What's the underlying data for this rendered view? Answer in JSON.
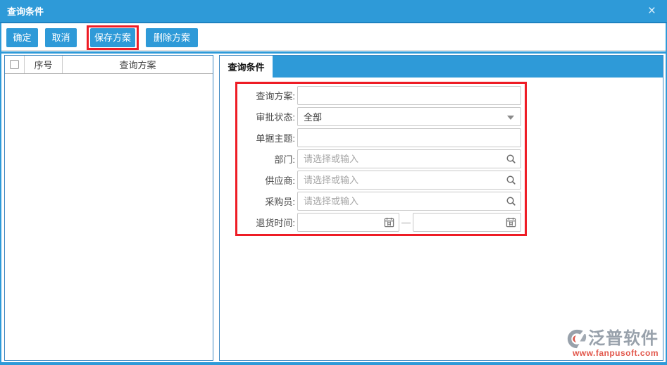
{
  "dialog": {
    "title": "查询条件",
    "close_glyph": "×"
  },
  "toolbar": {
    "buttons": [
      {
        "label": "确定",
        "highlighted": false
      },
      {
        "label": "取消",
        "highlighted": false
      },
      {
        "label": "保存方案",
        "highlighted": true
      },
      {
        "label": "删除方案",
        "highlighted": false
      }
    ]
  },
  "left_panel": {
    "columns": [
      "序号",
      "查询方案"
    ],
    "rows": []
  },
  "right_panel": {
    "active_tab": "查询条件",
    "form": {
      "fields": [
        {
          "label": "查询方案:",
          "type": "text",
          "value": "",
          "placeholder": ""
        },
        {
          "label": "审批状态:",
          "type": "select",
          "value": "全部"
        },
        {
          "label": "单据主题:",
          "type": "text",
          "value": "",
          "placeholder": ""
        },
        {
          "label": "部门:",
          "type": "lookup",
          "value": "",
          "placeholder": "请选择或输入"
        },
        {
          "label": "供应商:",
          "type": "lookup",
          "value": "",
          "placeholder": "请选择或输入"
        },
        {
          "label": "采购员:",
          "type": "lookup",
          "value": "",
          "placeholder": "请选择或输入"
        },
        {
          "label": "退货时间:",
          "type": "daterange",
          "start_value": "",
          "end_value": "",
          "separator": "—"
        }
      ]
    }
  },
  "watermark": {
    "brand": "泛普软件",
    "url": "www.fanpusoft.com"
  },
  "icons": {
    "close": "close-icon",
    "dropdown": "chevron-down-icon",
    "lookup": "search-icon",
    "date": "calendar-icon"
  },
  "colors": {
    "primary_blue": "#2e9ad8",
    "panel_border_blue": "#3c87c1",
    "annotation_red": "#ee1c25",
    "brand_gray": "#98a1ab",
    "brand_red": "#e2574b"
  }
}
